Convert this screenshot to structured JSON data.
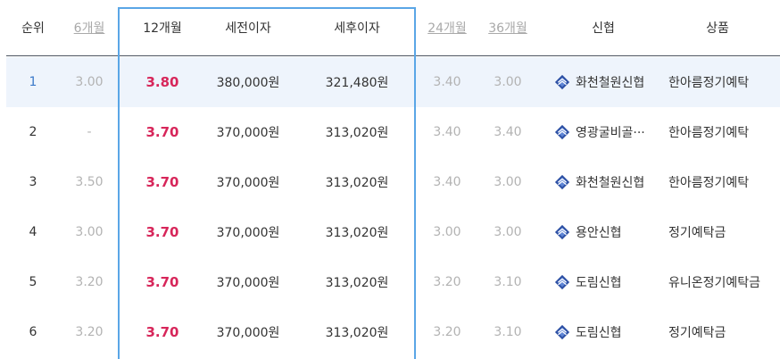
{
  "colors": {
    "accent_box": "#5aa6e6",
    "rate_red": "#d7265a",
    "rank_blue": "#3b79c9",
    "highlight_row": "#eef4fc"
  },
  "headers": {
    "rank": "순위",
    "m6": "6개월",
    "m12": "12개월",
    "pretax": "세전이자",
    "aftertax": "세후이자",
    "m24": "24개월",
    "m36": "36개월",
    "bank": "신협",
    "product": "상품"
  },
  "rows": [
    {
      "rank": "1",
      "m6": "3.00",
      "m12": "3.80",
      "pretax": "380,000원",
      "aftertax": "321,480원",
      "m24": "3.40",
      "m36": "3.00",
      "bank": "화천철원신협",
      "bank_icon": "shinhyup-logo-icon",
      "product": "한아름정기예탁"
    },
    {
      "rank": "2",
      "m6": "-",
      "m12": "3.70",
      "pretax": "370,000원",
      "aftertax": "313,020원",
      "m24": "3.40",
      "m36": "3.40",
      "bank": "영광굴비골···",
      "bank_icon": "shinhyup-logo-icon",
      "product": "한아름정기예탁"
    },
    {
      "rank": "3",
      "m6": "3.50",
      "m12": "3.70",
      "pretax": "370,000원",
      "aftertax": "313,020원",
      "m24": "3.40",
      "m36": "3.00",
      "bank": "화천철원신협",
      "bank_icon": "shinhyup-logo-icon",
      "product": "한아름정기예탁"
    },
    {
      "rank": "4",
      "m6": "3.00",
      "m12": "3.70",
      "pretax": "370,000원",
      "aftertax": "313,020원",
      "m24": "3.00",
      "m36": "3.00",
      "bank": "용안신협",
      "bank_icon": "shinhyup-logo-icon",
      "product": "정기예탁금"
    },
    {
      "rank": "5",
      "m6": "3.20",
      "m12": "3.70",
      "pretax": "370,000원",
      "aftertax": "313,020원",
      "m24": "3.20",
      "m36": "3.10",
      "bank": "도림신협",
      "bank_icon": "shinhyup-logo-icon",
      "product": "유니온정기예탁금"
    },
    {
      "rank": "6",
      "m6": "3.20",
      "m12": "3.70",
      "pretax": "370,000원",
      "aftertax": "313,020원",
      "m24": "3.20",
      "m36": "3.10",
      "bank": "도림신협",
      "bank_icon": "shinhyup-logo-icon",
      "product": "정기예탁금"
    }
  ]
}
